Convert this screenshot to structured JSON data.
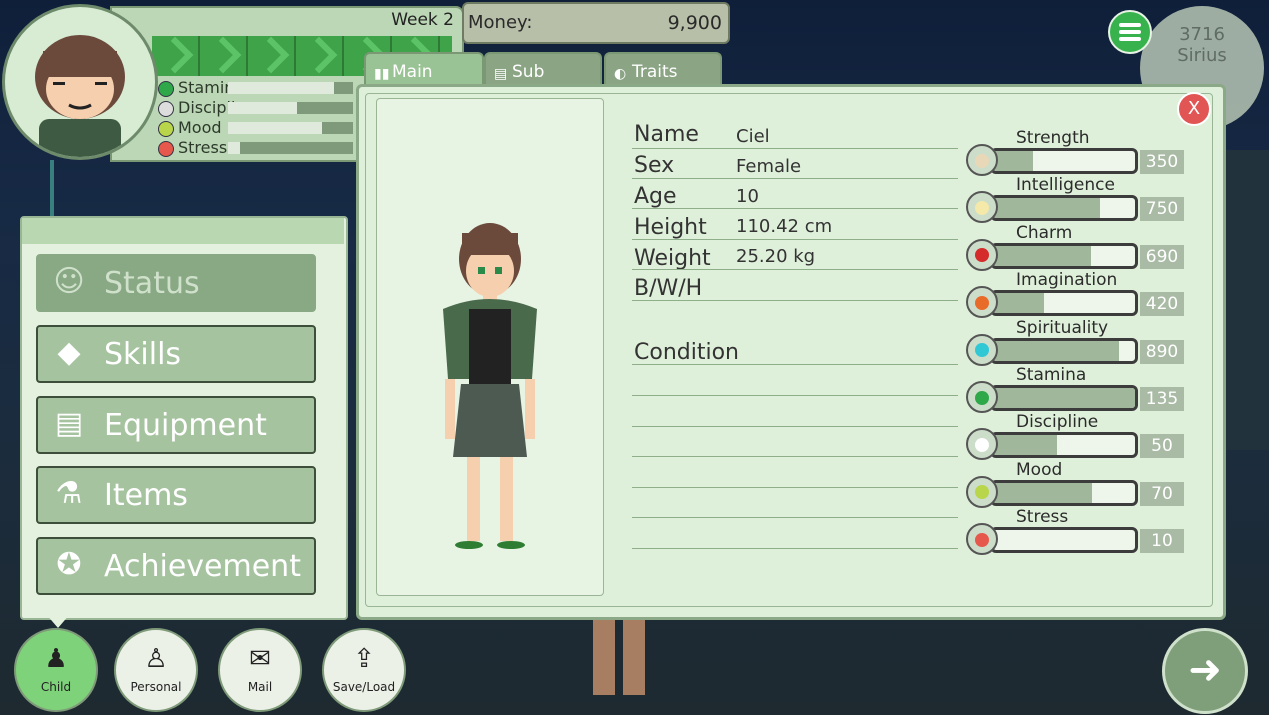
{
  "hud": {
    "week": "Week 2",
    "money_label": "Money:",
    "money_value": "9,900",
    "date_number": "3716",
    "date_place": "Sirius",
    "mini_stats": [
      {
        "label": "Stamina",
        "icon": "heart-icon",
        "level": 0.85
      },
      {
        "label": "Discipline",
        "icon": "glasses-icon",
        "level": 0.55
      },
      {
        "label": "Mood",
        "icon": "smile-icon",
        "level": 0.75
      },
      {
        "label": "Stress",
        "icon": "frown-icon",
        "level": 0.1
      }
    ]
  },
  "tabs": [
    {
      "label": "Main",
      "active": true
    },
    {
      "label": "Sub",
      "active": false
    },
    {
      "label": "Traits",
      "active": false
    }
  ],
  "close_label": "X",
  "profile": {
    "name_label": "Name",
    "name": "Ciel",
    "sex_label": "Sex",
    "sex": "Female",
    "age_label": "Age",
    "age": "10",
    "height_label": "Height",
    "height": "110.42 cm",
    "weight_label": "Weight",
    "weight": "25.20 kg",
    "bwh_label": "B/W/H",
    "bwh": "",
    "condition_label": "Condition"
  },
  "stats": [
    {
      "name": "Strength",
      "value": "350",
      "level": 0.28,
      "icon": "arm-icon",
      "color": "#e9d8b8"
    },
    {
      "name": "Intelligence",
      "value": "750",
      "level": 0.75,
      "icon": "lightbulb-icon",
      "color": "#f4e9a8"
    },
    {
      "name": "Charm",
      "value": "690",
      "level": 0.69,
      "icon": "lips-icon",
      "color": "#d52b2b"
    },
    {
      "name": "Imagination",
      "value": "420",
      "level": 0.36,
      "icon": "rainbow-icon",
      "color": "#e96b2a"
    },
    {
      "name": "Spirituality",
      "value": "890",
      "level": 0.89,
      "icon": "crystal-icon",
      "color": "#31c8d6"
    },
    {
      "name": "Stamina",
      "value": "135",
      "level": 1.0,
      "icon": "heart-icon",
      "color": "#2fa84a"
    },
    {
      "name": "Discipline",
      "value": "50",
      "level": 0.45,
      "icon": "glasses-icon",
      "color": "#ffffff"
    },
    {
      "name": "Mood",
      "value": "70",
      "level": 0.7,
      "icon": "smile-icon",
      "color": "#b9d64a"
    },
    {
      "name": "Stress",
      "value": "10",
      "level": 0.0,
      "icon": "frown-icon",
      "color": "#e5584b"
    }
  ],
  "menu": [
    {
      "label": "Status",
      "icon": "status-icon",
      "disabled": true
    },
    {
      "label": "Skills",
      "icon": "diamond-icon",
      "disabled": false
    },
    {
      "label": "Equipment",
      "icon": "dresser-icon",
      "disabled": false
    },
    {
      "label": "Items",
      "icon": "potion-icon",
      "disabled": false
    },
    {
      "label": "Achievement",
      "icon": "award-icon",
      "disabled": false
    }
  ],
  "bottom_nav": [
    {
      "label": "Child",
      "icon": "child-icon",
      "active": true
    },
    {
      "label": "Personal",
      "icon": "person-icon",
      "active": false
    },
    {
      "label": "Mail",
      "icon": "mail-icon",
      "active": false
    },
    {
      "label": "Save/Load",
      "icon": "save-icon",
      "active": false
    }
  ],
  "next_icon": "arrow-right-icon"
}
